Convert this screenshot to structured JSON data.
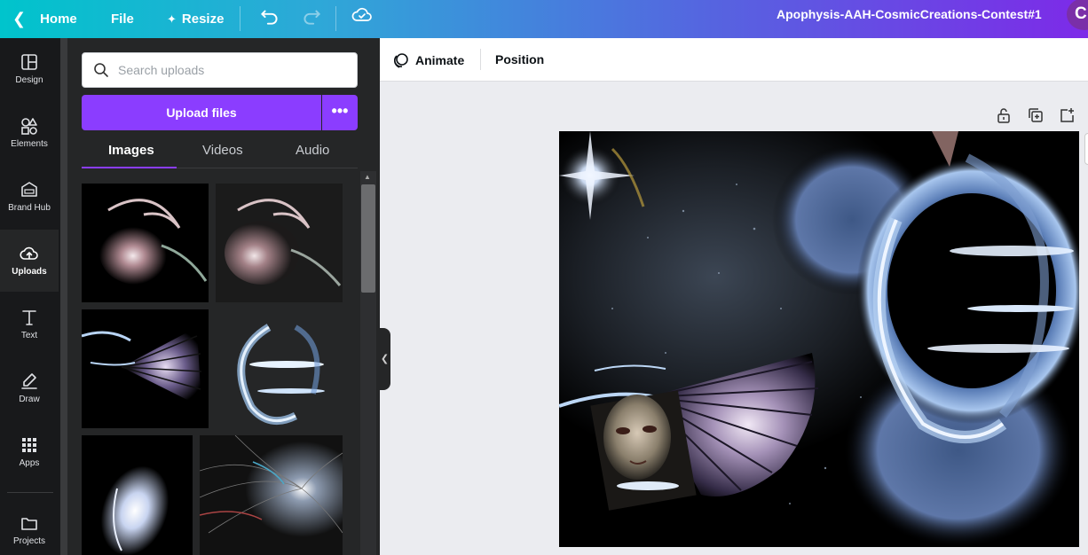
{
  "topbar": {
    "home_label": "Home",
    "file_label": "File",
    "resize_label": "Resize",
    "undo_icon": "undo-icon",
    "redo_icon": "redo-icon",
    "cloud_icon": "cloud-saved-icon",
    "document_title": "Apophysis-AAH-CosmicCreations-Contest#1",
    "avatar_initial": "C",
    "avatar_color": "#7a2fa8"
  },
  "rail": {
    "items": [
      {
        "label": "Design",
        "icon": "layout-icon"
      },
      {
        "label": "Elements",
        "icon": "shapes-icon"
      },
      {
        "label": "Brand Hub",
        "icon": "brand-icon"
      },
      {
        "label": "Uploads",
        "icon": "cloud-upload-icon"
      },
      {
        "label": "Text",
        "icon": "text-icon"
      },
      {
        "label": "Draw",
        "icon": "draw-icon"
      },
      {
        "label": "Apps",
        "icon": "apps-grid-icon"
      },
      {
        "label": "Projects",
        "icon": "folder-icon"
      }
    ],
    "active": "Uploads"
  },
  "panel": {
    "search_placeholder": "Search uploads",
    "upload_label": "Upload files",
    "more_label": "•••",
    "tabs": [
      {
        "label": "Images"
      },
      {
        "label": "Videos"
      },
      {
        "label": "Audio"
      }
    ],
    "active_tab": "Images",
    "accent_color": "#8b3dff"
  },
  "toolbar": {
    "animate_label": "Animate",
    "position_label": "Position"
  },
  "page_controls": {
    "lock_icon": "lock-icon",
    "duplicate_icon": "duplicate-page-icon",
    "add_icon": "add-page-icon"
  }
}
